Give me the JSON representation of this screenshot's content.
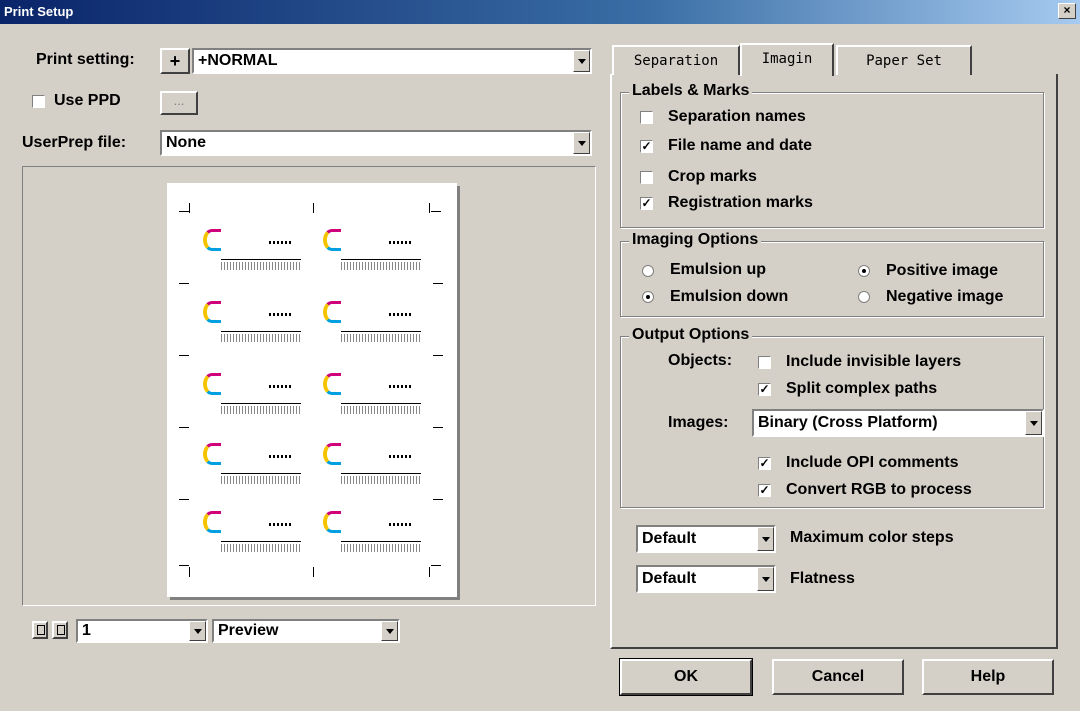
{
  "window": {
    "title": "Print Setup",
    "close_label": "×"
  },
  "left": {
    "print_setting_label": "Print setting:",
    "add_button_label": "+",
    "print_setting_value": "+NORMAL",
    "use_ppd_label": "Use PPD",
    "use_ppd_checked": false,
    "ppd_browse_label": "...",
    "userprep_label": "UserPrep file:",
    "userprep_value": "None",
    "page_value": "1",
    "view_value": "Preview"
  },
  "tabs": [
    {
      "label": "Separation",
      "active": false
    },
    {
      "label": "Imagin",
      "active": true
    },
    {
      "label": "Paper Set",
      "active": false
    }
  ],
  "labels_marks": {
    "title": "Labels & Marks",
    "items": [
      {
        "label": "Separation names",
        "checked": false
      },
      {
        "label": "File name and date",
        "checked": true
      },
      {
        "label": "Crop marks",
        "checked": false
      },
      {
        "label": "Registration marks",
        "checked": true
      }
    ]
  },
  "imaging_options": {
    "title": "Imaging Options",
    "emulsion_up": "Emulsion up",
    "emulsion_down": "Emulsion down",
    "positive_image": "Positive image",
    "negative_image": "Negative image",
    "emulsion_selected": "down",
    "image_selected": "positive"
  },
  "output_options": {
    "title": "Output Options",
    "objects_label": "Objects:",
    "include_invisible": {
      "label": "Include invisible layers",
      "checked": false
    },
    "split_complex": {
      "label": "Split complex paths",
      "checked": true
    },
    "images_label": "Images:",
    "images_value": "Binary (Cross Platform)",
    "include_opi": {
      "label": "Include OPI comments",
      "checked": true
    },
    "convert_rgb": {
      "label": "Convert RGB to process",
      "checked": true
    }
  },
  "max_color_steps": {
    "value": "Default",
    "label": "Maximum color steps"
  },
  "flatness": {
    "value": "Default",
    "label": "Flatness"
  },
  "buttons": {
    "ok": "OK",
    "cancel": "Cancel",
    "help": "Help"
  }
}
